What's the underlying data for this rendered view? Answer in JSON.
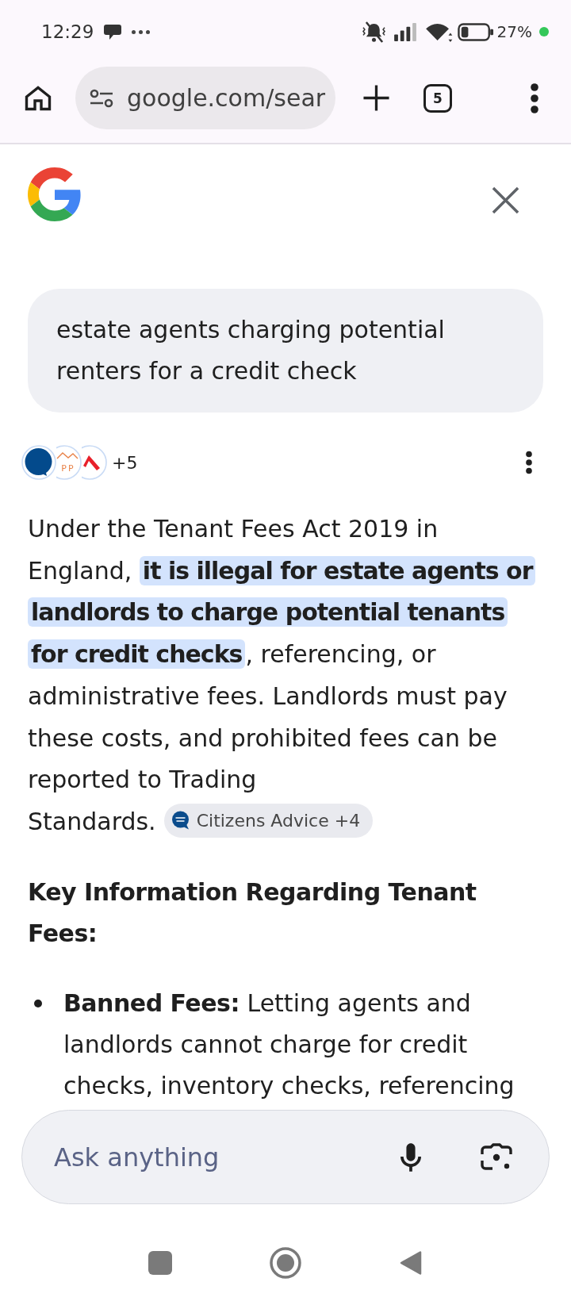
{
  "status_bar": {
    "time": "12:29",
    "battery": "27%"
  },
  "browser_bar": {
    "url": "google.com/sear",
    "tab_count": "5"
  },
  "query": "estate agents charging potential renters for a credit check",
  "sources": {
    "logos": [
      {
        "kind": "bubble"
      },
      {
        "kind": "house",
        "text": "PP"
      },
      {
        "kind": "chevron"
      }
    ],
    "more": "+5"
  },
  "answer": {
    "text": "Under the Tenant Fees Act 2019 in England, **it is illegal for estate agents or landlords to charge potential tenants for credit checks**, referencing, or administrative fees. Landlords must pay these costs, and prohibited fees can be reported to Trading Standards.",
    "citation": "Citizens Advice +4"
  },
  "heading": "Key Information Regarding Tenant Fees:",
  "bullets": [
    "**Banned Fees:** Letting agents and landlords cannot charge for credit checks, inventory checks, referencing"
  ],
  "ask_bar": {
    "placeholder": "Ask anything"
  }
}
